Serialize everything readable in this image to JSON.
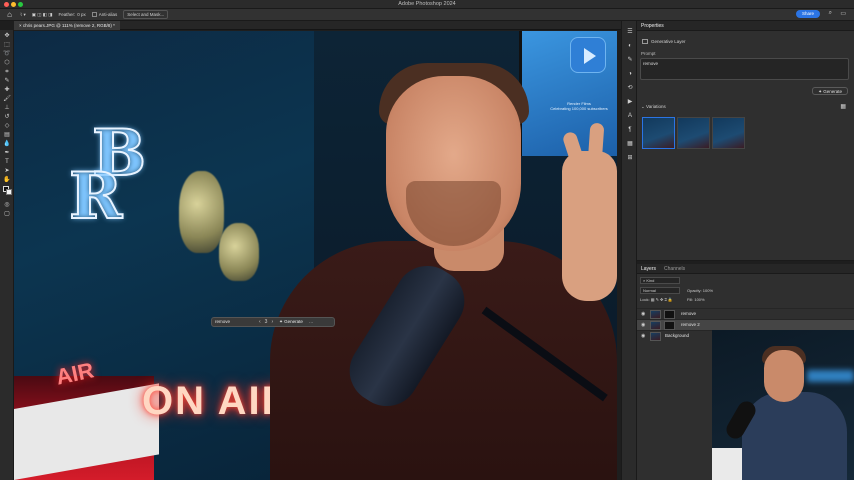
{
  "app": {
    "title": "Adobe Photoshop 2024",
    "share_label": "Share"
  },
  "options_bar": {
    "feather_label": "Feather:",
    "feather_value": "0 px",
    "anti_alias_label": "Anti-alias",
    "select_mask_label": "Select and Mask..."
  },
  "document": {
    "tab_title": "chris pears.JPG @ 111% (remove 2, RGB/8) *"
  },
  "canvas_text": {
    "neon_main": "ON AIR",
    "neon_small": "AIR",
    "monitor_title": "Render Films",
    "monitor_sub": "Celebrating 100,000 subscribers"
  },
  "contextual_taskbar": {
    "prompt_value": "remove",
    "nav_left": "‹",
    "page": "3",
    "nav_right": "›",
    "generate_label": "Generate",
    "more_icon": "ellipsis-icon"
  },
  "properties": {
    "tab": "Properties",
    "layer_type": "Generative Layer",
    "prompt_label": "Prompt",
    "prompt_value": "remove",
    "generate_label": "Generate",
    "variations_label": "Variations",
    "variations_count": 3
  },
  "layers": {
    "tabs": [
      "Layers",
      "Channels"
    ],
    "filter_label": "Kind",
    "blend_mode": "Normal",
    "opacity_label": "Opacity:",
    "opacity_value": "100%",
    "lock_label": "Lock:",
    "fill_label": "Fill:",
    "fill_value": "100%",
    "items": [
      {
        "name": "remove"
      },
      {
        "name": "remove 2"
      },
      {
        "name": "Background"
      }
    ]
  },
  "colors": {
    "accent": "#2b74e4",
    "panel": "#2f2f2f",
    "toolbar": "#2b2b2b"
  }
}
